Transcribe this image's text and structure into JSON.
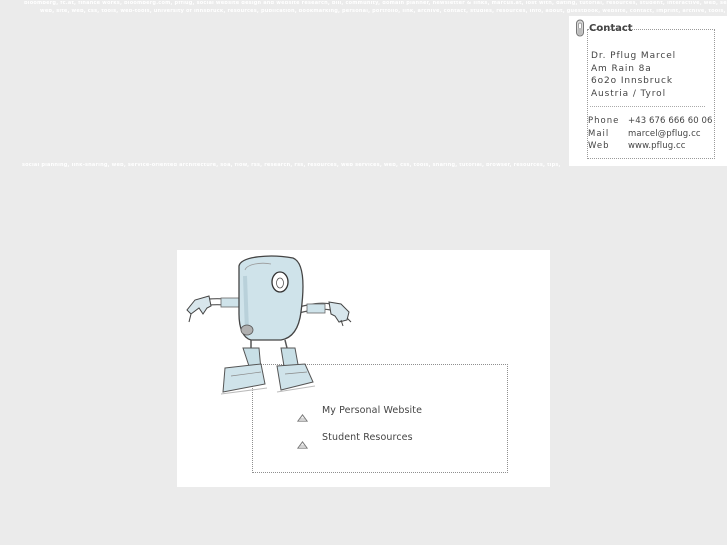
{
  "ticker": {
    "line1": "bloomberg, fc.at, finance works, bloomberg.com, pfflug, social website design and website research, bill, community, domain planner, newsletter & links, marcus.at, lost with, dating, tutorial, resources, student, interactive, web, search",
    "line2": "web, site, web, css, tools, web-tools, university of innsbruck, resources, publication, bookmarking, personal, portfolio, link, archive, contact, studies, resources, info, about, guestbook, website, contact, imprint, archive, tools, ",
    "line3": "social planning, link-sharing, web, service-oriented architecture, soa, flow, rss, research, rss, resources, web services, web, css, tools, sharing, tutorial, browser, resources, tips, website, info"
  },
  "contact": {
    "title": "Contact",
    "icon": "paperclip-icon",
    "address": {
      "name": "Dr. Pflug Marcel",
      "street": "Am Rain 8a",
      "city": "6o2o Innsbruck",
      "country": "Austria / Tyrol"
    },
    "details": [
      {
        "label": "Phone",
        "value": "+43 676 666 60 06"
      },
      {
        "label": "Mail",
        "value": "marcel@pflug.cc"
      },
      {
        "label": "Web",
        "value": "www.pflug.cc"
      }
    ]
  },
  "links": [
    {
      "label": "My Personal Website",
      "icon": "triangle-icon"
    },
    {
      "label": "Student Resources",
      "icon": "triangle-icon"
    }
  ],
  "colors": {
    "background": "#ebebeb",
    "panel": "#ffffff",
    "text": "#444444",
    "robot": "#cfe3ea"
  }
}
